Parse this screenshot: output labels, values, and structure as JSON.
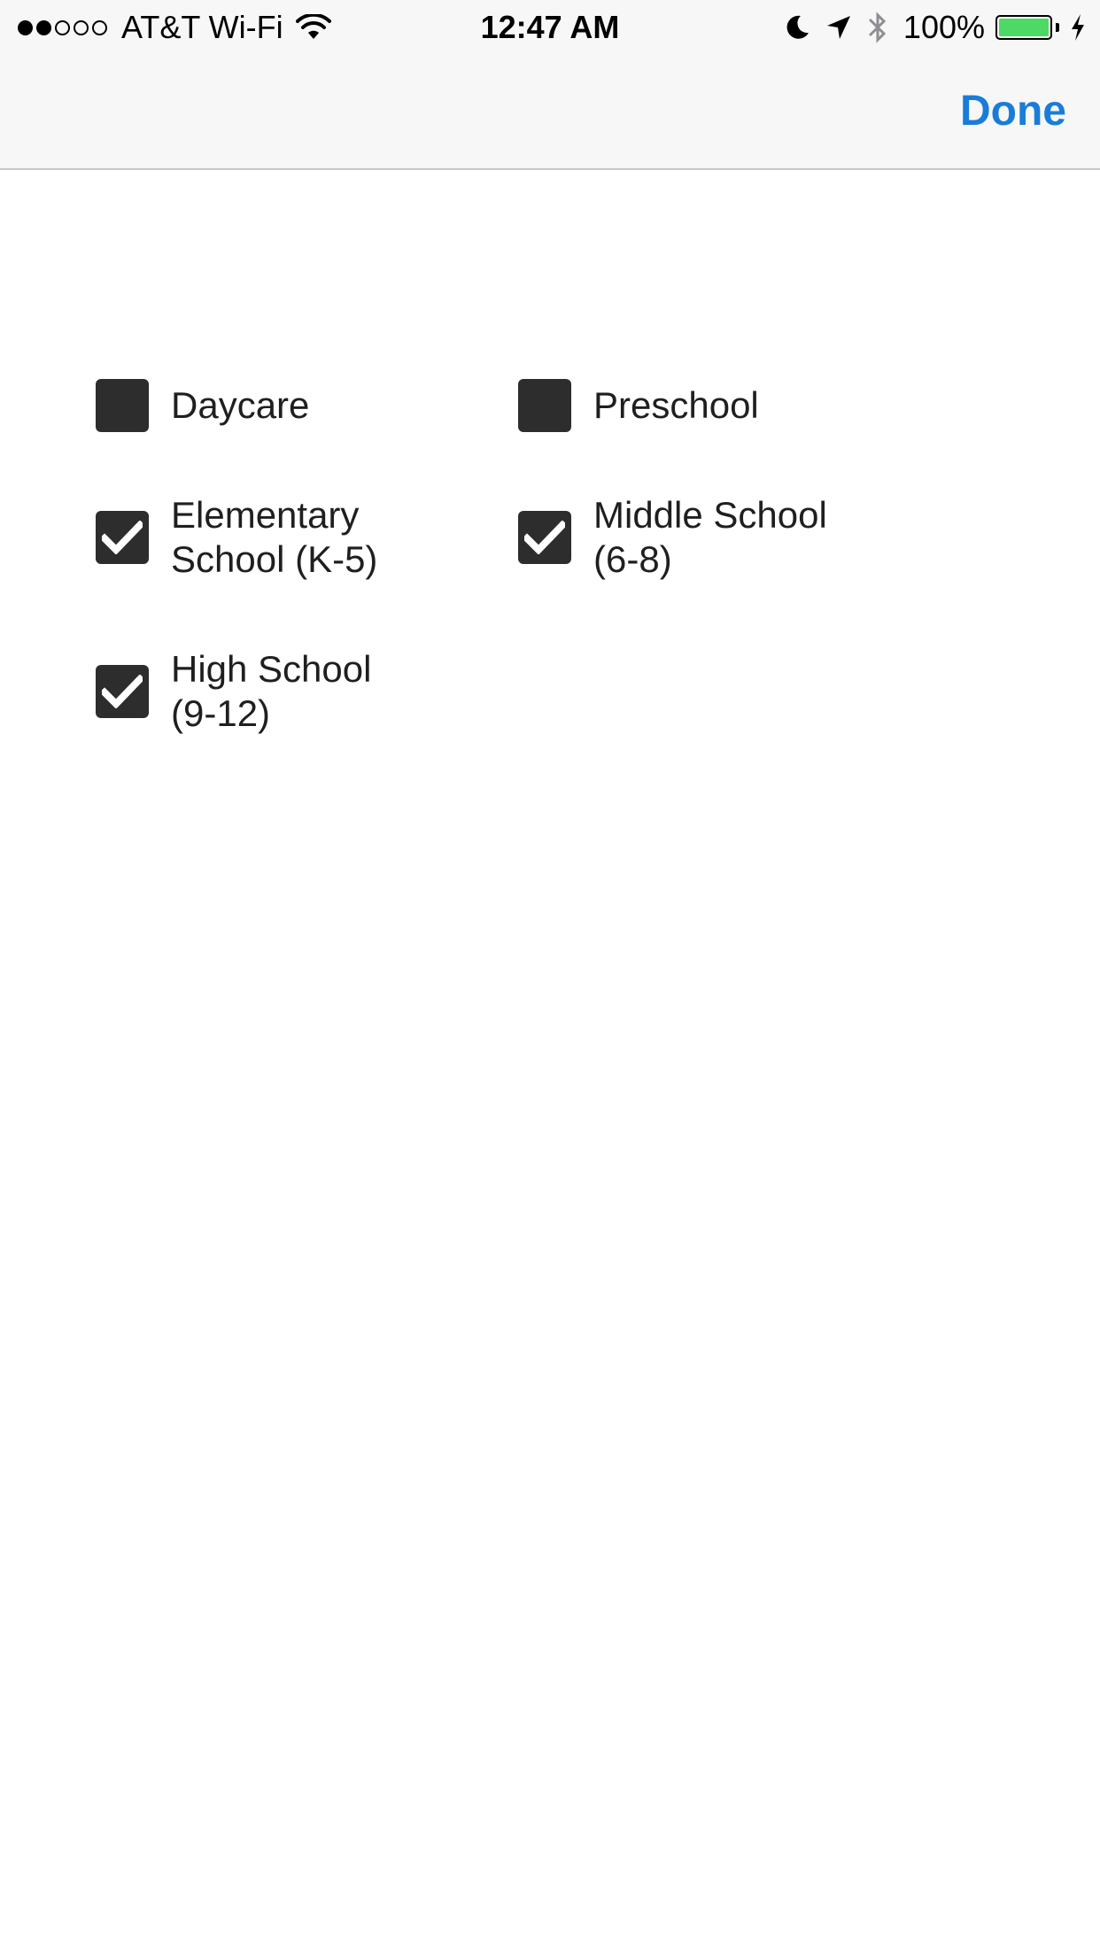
{
  "status_bar": {
    "signal_bars_filled": 2,
    "signal_bars_total": 5,
    "carrier": "AT&T Wi-Fi",
    "time": "12:47 AM",
    "battery_percent": "100%",
    "battery_level": 1.0,
    "battery_color": "#4cd964",
    "icons": [
      "wifi-icon",
      "moon-icon",
      "location-icon",
      "bluetooth-icon",
      "battery-icon",
      "charging-icon"
    ]
  },
  "nav": {
    "done_label": "Done",
    "accent_color": "#1a7cd9"
  },
  "options": [
    {
      "label": "Daycare",
      "checked": false
    },
    {
      "label": "Preschool",
      "checked": false
    },
    {
      "label": "Elementary\nSchool (K-5)",
      "checked": true
    },
    {
      "label": "Middle School\n(6-8)",
      "checked": true
    },
    {
      "label": "High School\n(9-12)",
      "checked": true
    }
  ]
}
